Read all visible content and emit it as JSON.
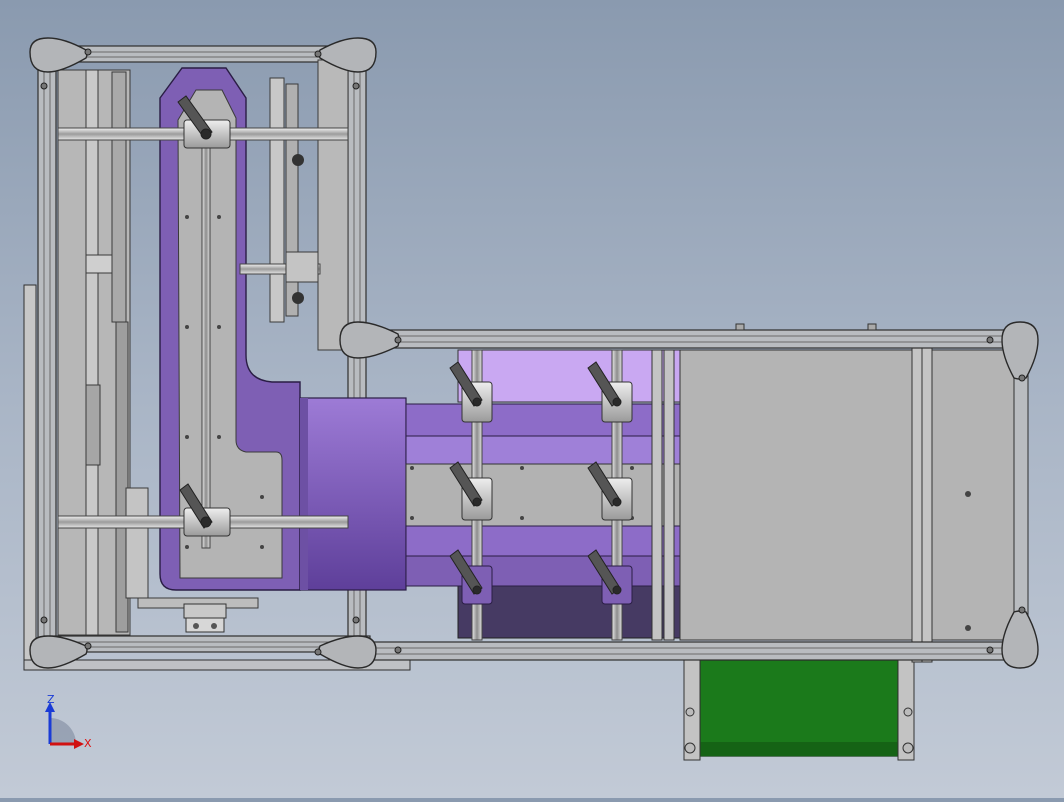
{
  "scene": {
    "view": "front",
    "colors": {
      "background_top": "#8a9aaf",
      "background_bottom": "#c2cad6",
      "frame": "#a8abb0",
      "frame_edge": "#3a3a3a",
      "panel_gray": "#b4b4b4",
      "purple": "#7e5fb4",
      "purple_light": "#a883dc",
      "lavender": "#c9a8f2",
      "dark_purple": "#463a63",
      "belt_green": "#1b7a1b",
      "knob_gray": "#555555",
      "clamp_light": "#d7d7d7"
    },
    "parts": [
      "left-frame",
      "right-frame",
      "vertical-plate",
      "lead-screw",
      "shaft",
      "clamp-block",
      "clamp-lever",
      "corner-bracket",
      "guide-rail",
      "gray-panel",
      "conveyor-belt",
      "triad"
    ]
  },
  "triad": {
    "labels": {
      "z": "Z",
      "x": "X"
    },
    "colors": {
      "z": "#1a3bd6",
      "x": "#d11111"
    }
  }
}
